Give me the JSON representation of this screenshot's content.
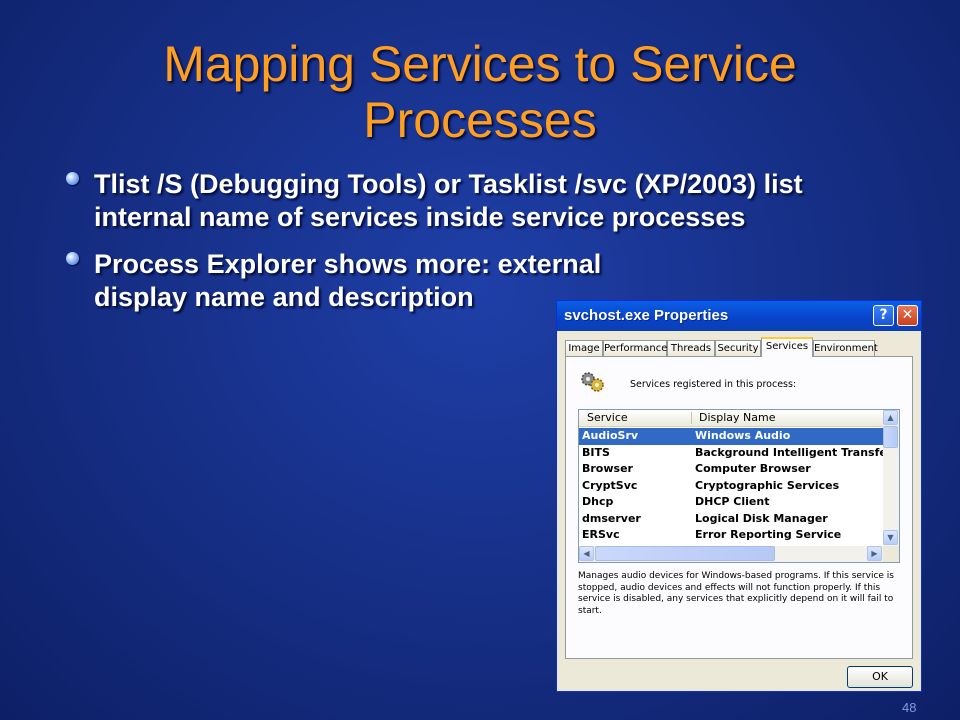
{
  "slide": {
    "title": "Mapping Services to Service Processes",
    "bullets": [
      "Tlist /S (Debugging Tools) or Tasklist /svc (XP/2003) list internal name of services inside service processes",
      "Process Explorer shows more: external display name and description"
    ],
    "page_number": "48"
  },
  "window": {
    "title": "svchost.exe Properties",
    "help_glyph": "?",
    "close_glyph": "✕",
    "tabs": [
      "Image",
      "Performance",
      "Threads",
      "Security",
      "Services",
      "Environment"
    ],
    "active_tab": "Services",
    "registered_label": "Services registered in this process:",
    "columns": [
      "Service",
      "Display Name"
    ],
    "rows": [
      {
        "service": "AudioSrv",
        "display": "Windows Audio",
        "selected": true
      },
      {
        "service": "BITS",
        "display": "Background Intelligent Transfe"
      },
      {
        "service": "Browser",
        "display": "Computer Browser"
      },
      {
        "service": "CryptSvc",
        "display": "Cryptographic Services"
      },
      {
        "service": "Dhcp",
        "display": "DHCP Client"
      },
      {
        "service": "dmserver",
        "display": "Logical Disk Manager"
      },
      {
        "service": "ERSvc",
        "display": "Error Reporting Service"
      }
    ],
    "description": "Manages audio devices for Windows-based programs. If this service is stopped, audio devices and effects will not function properly. If this service is disabled, any services that explicitly depend on it will fail to start.",
    "ok_label": "OK"
  },
  "colors": {
    "title_orange": "#ff9e1f",
    "background_blue": "#17318a",
    "selection_blue": "#316ac5"
  }
}
